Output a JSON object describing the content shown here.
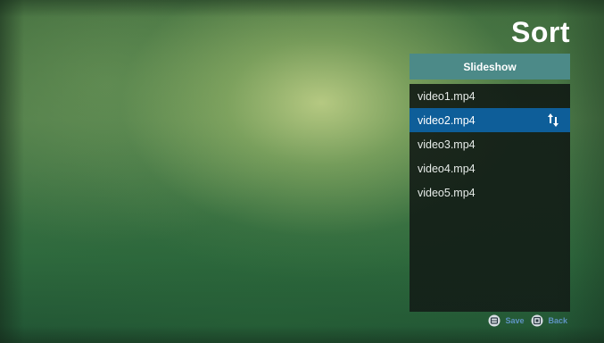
{
  "page": {
    "title": "Sort"
  },
  "playlist": {
    "name": "Slideshow",
    "items": [
      {
        "label": "video1.mp4",
        "selected": false
      },
      {
        "label": "video2.mp4",
        "selected": true
      },
      {
        "label": "video3.mp4",
        "selected": false
      },
      {
        "label": "video4.mp4",
        "selected": false
      },
      {
        "label": "video5.mp4",
        "selected": false
      }
    ],
    "selected_item_icon": "reorder-arrows-icon"
  },
  "footer": {
    "save_label": "Save",
    "save_icon": "remote-button-icon",
    "back_label": "Back",
    "back_icon": "remote-button-icon"
  },
  "colors": {
    "header_bg": "#4c8a88",
    "selection_bg": "#0e5e99",
    "hint_text": "#5f93c3"
  }
}
